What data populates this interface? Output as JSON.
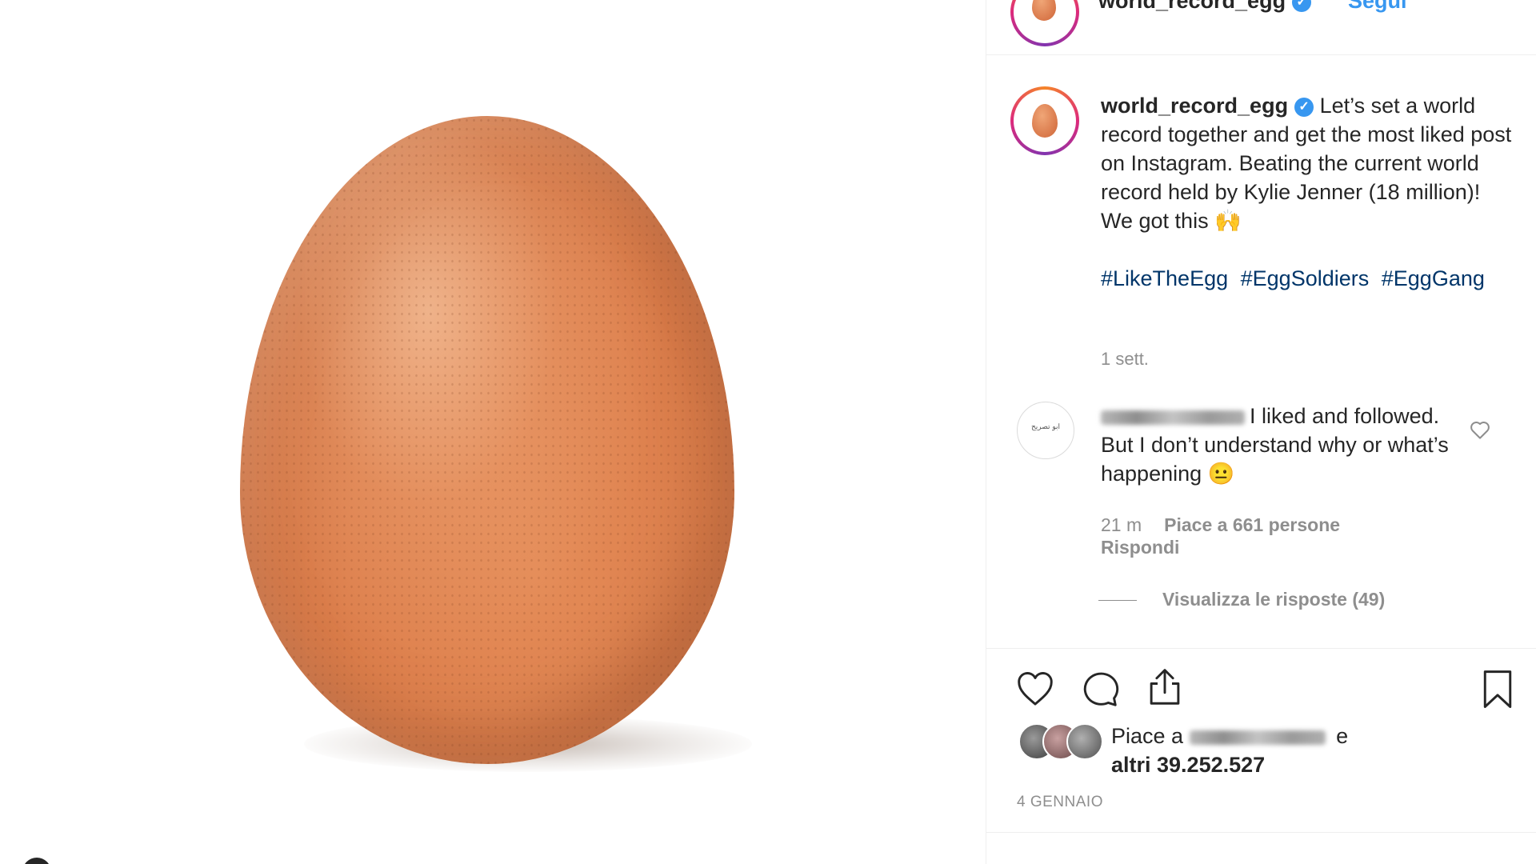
{
  "header": {
    "username": "world_record_egg",
    "follow_label": "Segui"
  },
  "post": {
    "caption": {
      "username": "world_record_egg",
      "text": "Let’s set a world record together and get the most liked post on Instagram. Beating the current world record held by Kylie Jenner (18 million)! We got this 🙌",
      "hashtags": [
        "#LikeTheEgg",
        "#EggSoldiers",
        "#EggGang"
      ],
      "time": "1 sett."
    },
    "comment": {
      "avatar_text": "ﺍﺑﻮ ﺗﺼﺮﻳﺢ",
      "text": "I liked and followed. But I don’t understand why or what’s happening 😐",
      "time": "21 m",
      "likes": "Piace a 661 persone",
      "reply_label": "Rispondi",
      "view_replies": "Visualizza le risposte (49)"
    },
    "likes": {
      "prefix": "Piace a",
      "suffix": "e",
      "count_text": "altri 39.252.527"
    },
    "date": "4 GENNAIO"
  },
  "icons": {
    "like": "heart-icon",
    "comment": "comment-bubble-icon",
    "share": "share-icon",
    "save": "bookmark-icon",
    "verified": "verified-badge-icon"
  },
  "colors": {
    "link": "#3897f0",
    "hashtag": "#003569",
    "muted": "#8e8e8e",
    "text": "#262626",
    "egg": "#dd7f4c"
  }
}
